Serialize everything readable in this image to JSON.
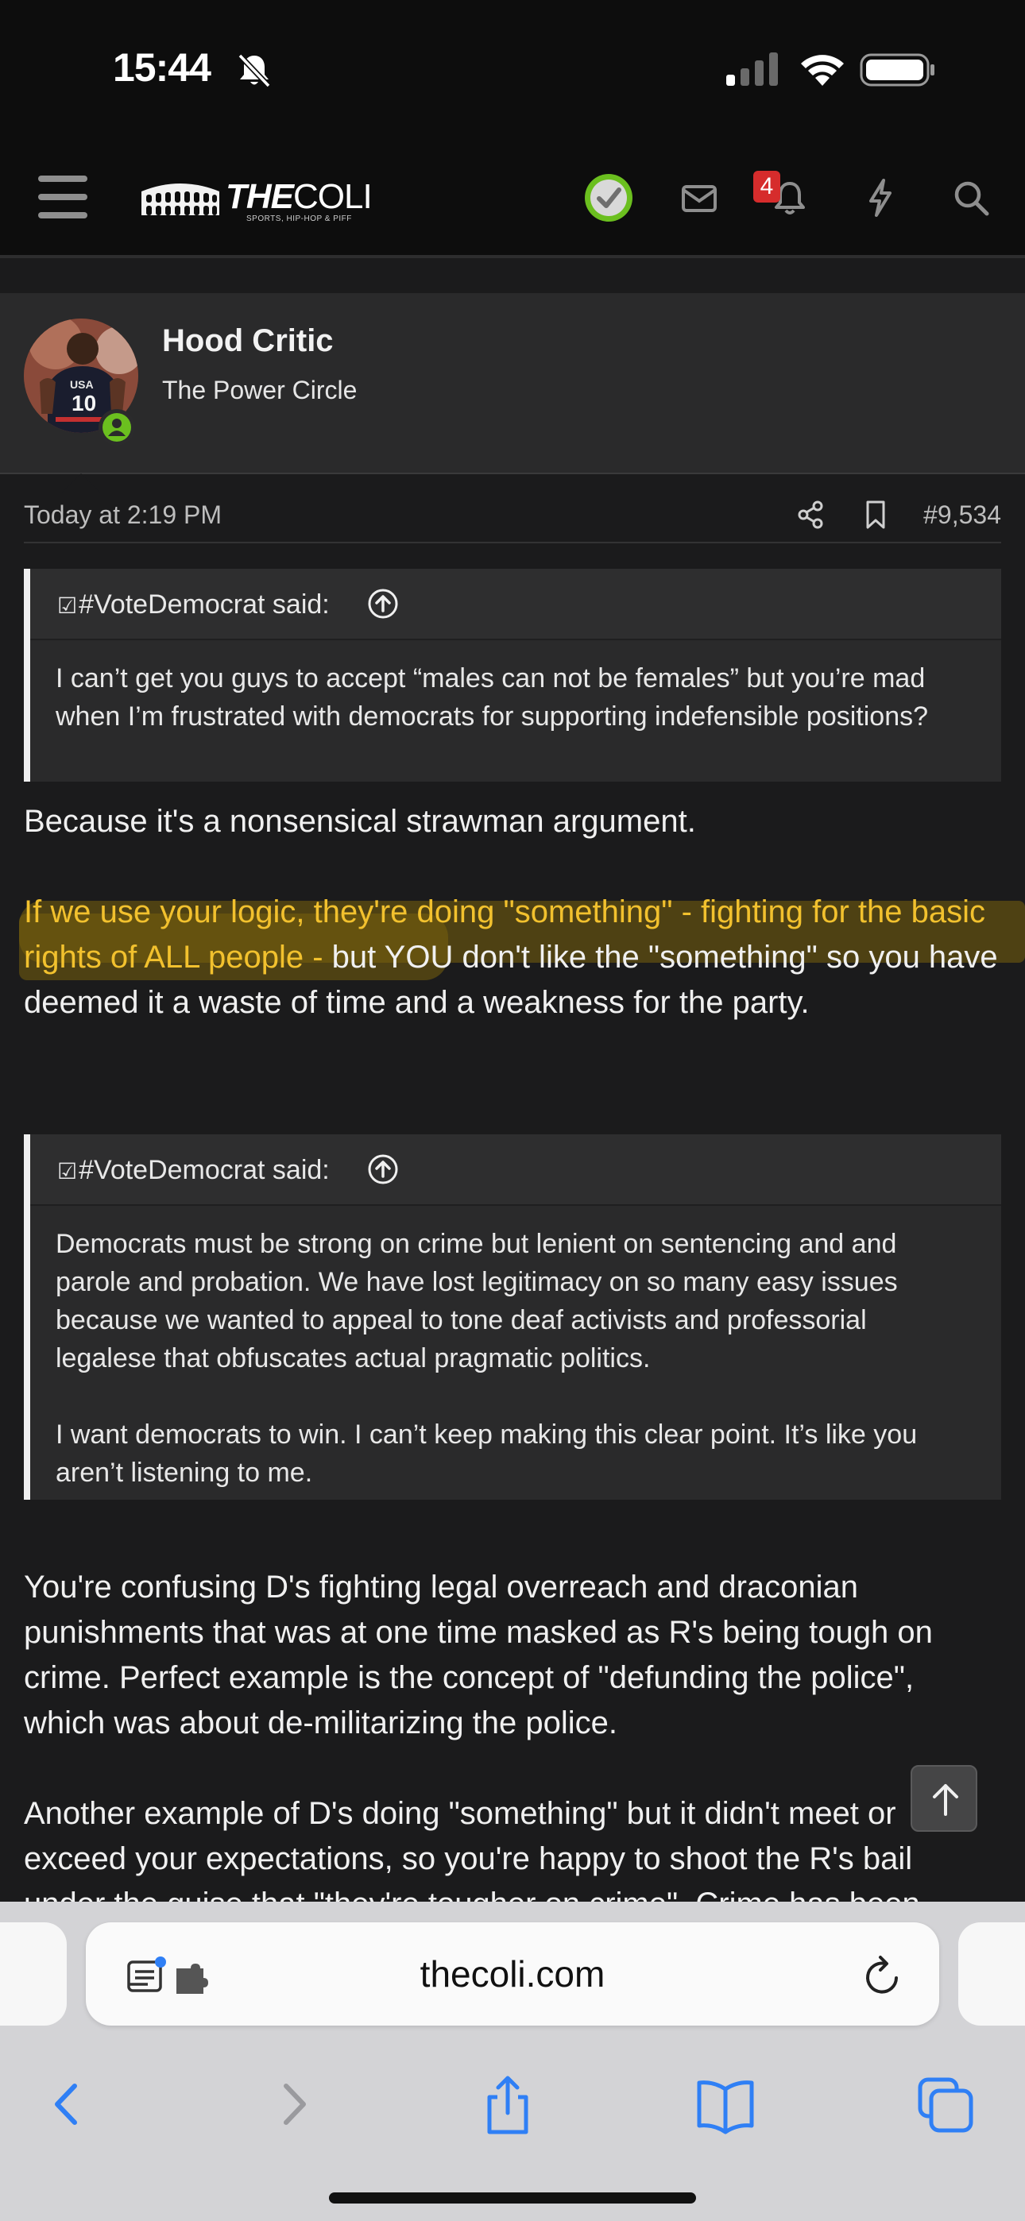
{
  "status_bar": {
    "time": "15:44"
  },
  "header": {
    "logo_text_bold": "THE",
    "logo_text_light": "COLI",
    "logo_subtitle": "SPORTS, HIP-HOP & PIFF",
    "notification_count": "4"
  },
  "author": {
    "name": "Hood Critic",
    "title": "The Power Circle"
  },
  "post": {
    "date": "Today at 2:19 PM",
    "number": "#9,534"
  },
  "quote1": {
    "ballot": "☑",
    "author": "#VoteDemocrat said:",
    "text": "I can’t get you guys to accept “males can not be females” but you’re mad when I’m frustrated with democrats for supporting indefensible positions?"
  },
  "body": {
    "p1": "Because it's a nonsensical strawman argument.",
    "p2_highlight": "If we use your logic, they're doing \"something\" - fighting for the basic rights of ALL people -",
    "p2_rest": " but YOU don't like the \"something\" so you have deemed it a waste of time and a weakness for the party."
  },
  "quote2": {
    "ballot": "☑",
    "author": "#VoteDemocrat said:",
    "p1": "Democrats must be strong on crime but lenient on sentencing and and parole and probation. We have lost legitimacy on so many easy issues because we wanted to appeal to tone deaf activists and professorial legalese that obfuscates actual pragmatic politics.",
    "p2": "I want democrats to win. I can’t keep making this clear point. It’s like you aren’t listening to me."
  },
  "body2": {
    "p1": "You're confusing D's fighting legal overreach and draconian punishments that was at one time masked as R's being tough on crime. Perfect example is the concept of \"defunding the police\", which was about de-militarizing the police.",
    "p2": "Another example of D's doing \"something\" but it didn't meet or exceed your expectations, so you're happy to shoot the R's bail under the guise that \"they're tougher on crime\". Crime has been"
  },
  "safari": {
    "url": "thecoli.com"
  },
  "colors": {
    "highlight_text": "#f2c12e",
    "online_green": "#6bbf1f",
    "badge_red": "#d62c2c",
    "safari_blue": "#2f7ff5"
  }
}
